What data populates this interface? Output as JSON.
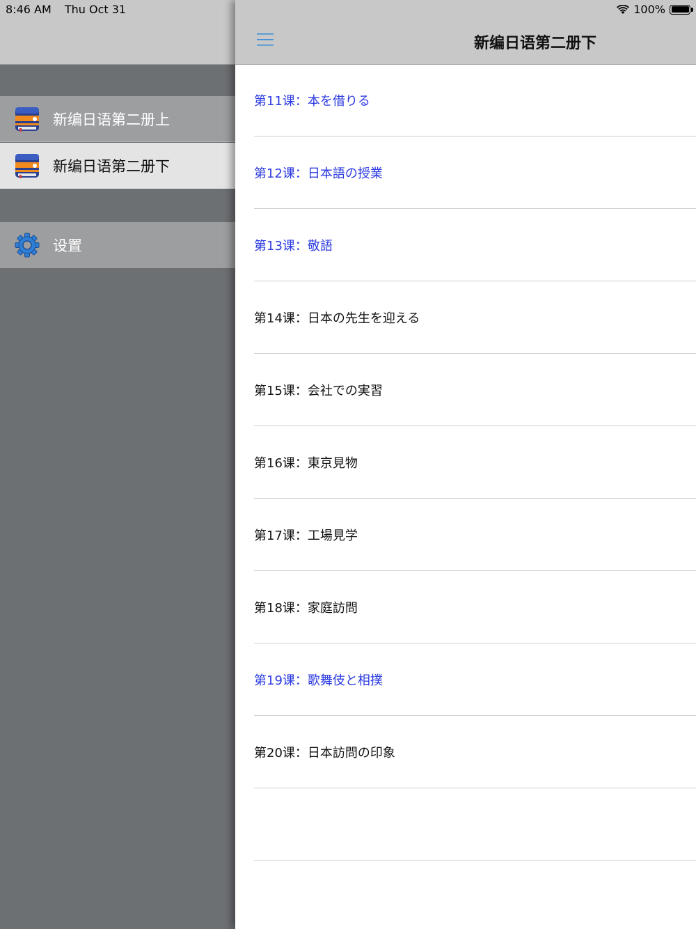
{
  "status_bar": {
    "time": "8:46 AM",
    "date": "Thu Oct 31",
    "battery": "100%",
    "battery_level": 1.0,
    "wifi_icon": "wifi-icon",
    "battery_icon": "battery-icon"
  },
  "sidebar": {
    "items": [
      {
        "label": "新编日语第二册上",
        "icon": "book-icon"
      },
      {
        "label": "新编日语第二册下",
        "icon": "book-icon",
        "selected": true
      },
      {
        "label": "设置",
        "icon": "gear-icon"
      }
    ]
  },
  "navbar": {
    "title": "新编日语第二册下",
    "menu_icon": "hamburger-menu-icon"
  },
  "lessons": [
    {
      "label": "第11课：本を借りる",
      "visited": true
    },
    {
      "label": "第12课：日本語の授業",
      "visited": true
    },
    {
      "label": "第13课：敬語",
      "visited": true
    },
    {
      "label": "第14课：日本の先生を迎える",
      "visited": false
    },
    {
      "label": "第15课：会社での実習",
      "visited": false
    },
    {
      "label": "第16课：東京見物",
      "visited": false
    },
    {
      "label": "第17课：工場見学",
      "visited": false
    },
    {
      "label": "第18课：家庭訪問",
      "visited": false
    },
    {
      "label": "第19课：歌舞伎と相撲",
      "visited": true
    },
    {
      "label": "第20课：日本訪問の印象",
      "visited": false
    }
  ],
  "colors": {
    "visited_link": "#2b3ae0",
    "menu_icon": "#3a8fd9",
    "sidebar_bg": "#6d7073",
    "selected_item_bg": "#e4e4e5"
  }
}
